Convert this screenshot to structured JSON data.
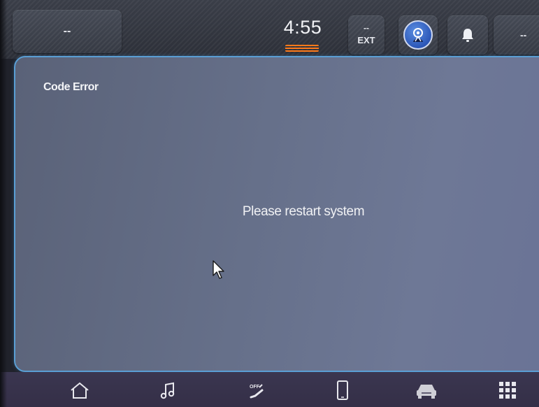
{
  "status_bar": {
    "left_tile": "--",
    "clock": "4:55",
    "ext": {
      "value": "--",
      "label": "EXT"
    },
    "profile_icon": "driver-profile-icon",
    "notification_icon": "bell-icon",
    "right_tile": "--"
  },
  "dialog": {
    "title": "Code Error",
    "message": "Please restart system"
  },
  "nav_bar": {
    "items": [
      {
        "name": "home",
        "icon": "home-icon"
      },
      {
        "name": "media",
        "icon": "music-note-icon"
      },
      {
        "name": "climate",
        "icon": "seat-climate-off-icon",
        "icon_text": "OFF"
      },
      {
        "name": "phone",
        "icon": "smartphone-icon"
      },
      {
        "name": "vehicle",
        "icon": "car-icon"
      },
      {
        "name": "apps",
        "icon": "grid-icon"
      }
    ]
  },
  "colors": {
    "panel_border": "#5a9ed4",
    "clock_indicator": "#ff7a1a",
    "profile_badge": "#2c57b8"
  }
}
